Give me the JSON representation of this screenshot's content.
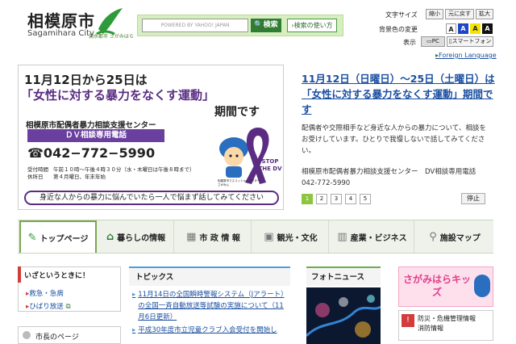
{
  "header": {
    "city_name": "相模原市",
    "city_name_en": "Sagamihara City",
    "logo_caption": "潤水都市 さがみはら"
  },
  "search": {
    "placeholder": "POWERED BY YAHOO! JAPAN",
    "button_label": "検索",
    "help_label": "検索の使い方"
  },
  "controls": {
    "text_size_label": "文字サイズ",
    "text_size_options": [
      "縮小",
      "元に戻す",
      "拡大"
    ],
    "bg_color_label": "背景色の変更",
    "bg_color_options": [
      "A",
      "A",
      "A",
      "A"
    ],
    "display_label": "表示",
    "display_options": [
      "PC",
      "スマートフォン"
    ],
    "foreign_language": "Foreign Language"
  },
  "banner": {
    "date_line": "11月12日から25日は",
    "campaign": "「女性に対する暴力をなくす運動」",
    "period": "期間です",
    "center": "相模原市配偶者暴力相談支援センター",
    "hotline_label": "ＤＶ相談専用電話",
    "phone": "☎042−772−5990",
    "hours_label": "受付時間",
    "hours": "午前１０時〜午後４時３０分（水・木曜日は午後８時まで）",
    "holiday_label": "休所日",
    "holiday": "第４月曜日、年末年始",
    "ribbon_text": "STOP THE DV",
    "mascot_caption": "相模原市マスコットキャラクター さがみん",
    "footer": "身近な人からの暴力に悩んでいたら一人で悩まず話してみてください"
  },
  "news": {
    "title": "11月12日（日曜日）〜25日（土曜日）は「女性に対する暴力をなくす運動」期間です",
    "body": "配偶者や交際相手など身近な人からの暴力について、相談をお受けしています。ひとりで我慢しないで話してみてください。",
    "center": "相模原市配偶者暴力相談支援センター　DV相談専用電話　042-772-5990",
    "pages": [
      "1",
      "2",
      "3",
      "4",
      "5"
    ],
    "stop_label": "停止"
  },
  "nav": {
    "items": [
      {
        "label": "トップページ",
        "icon": "city-logo-icon"
      },
      {
        "label": "暮らしの情報",
        "icon": "house-icon"
      },
      {
        "label": "市 政 情 報",
        "icon": "building-icon"
      },
      {
        "label": "観光・文化",
        "icon": "photo-icon"
      },
      {
        "label": "産業・ビジネス",
        "icon": "chart-icon"
      },
      {
        "label": "施設マップ",
        "icon": "map-pin-icon"
      }
    ]
  },
  "emergency": {
    "title": "いざというときに！",
    "links": [
      "救急・急病",
      "ひばり放送"
    ]
  },
  "mayor": {
    "title": "市長のページ"
  },
  "topics": {
    "title": "トピックス",
    "items": [
      "11月14日の全国瞬時警報システム（Jアラート）の全国一斉自動放送等試験の実施について（11月6日更新）",
      "平成30年度市立児童クラブ入会受付を開始し"
    ]
  },
  "photo_news": {
    "title": "フォトニュース"
  },
  "kids": {
    "label": "さがみはらキッズ"
  },
  "disaster": {
    "line1": "防災・危機管理情報",
    "line2": "消防情報"
  },
  "colors": {
    "accent_green": "#2e7d32",
    "link_blue": "#1a4fa0",
    "banner_purple": "#5a2d82"
  }
}
